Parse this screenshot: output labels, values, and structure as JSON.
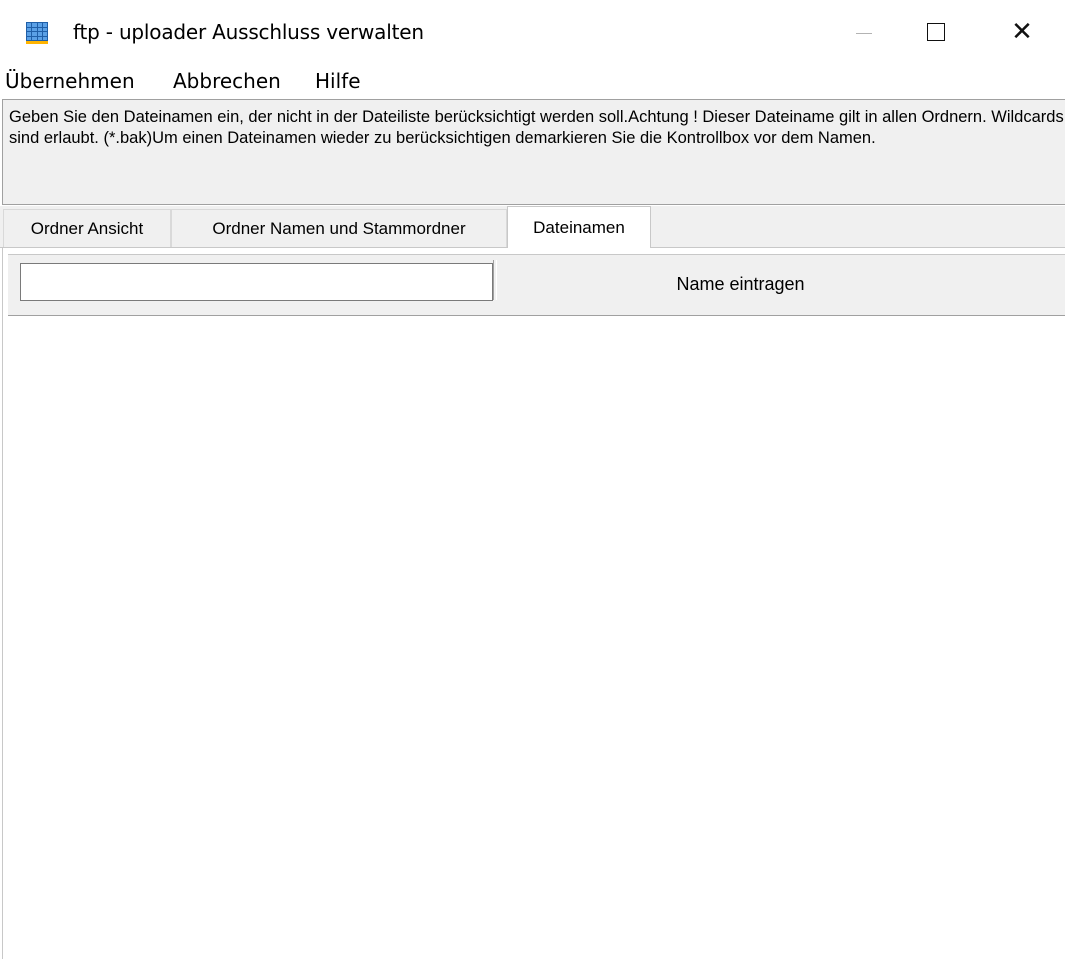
{
  "window": {
    "icon": "app-grid-icon",
    "title": "ftp - uploader  Ausschluss verwalten",
    "controls": {
      "minimize": "minimize-icon",
      "maximize": "maximize-icon",
      "close": "close-icon",
      "close_glyph": "✕"
    }
  },
  "menu": {
    "items": [
      {
        "label": "Übernehmen"
      },
      {
        "label": "Abbrechen"
      },
      {
        "label": "Hilfe"
      }
    ]
  },
  "info": {
    "text": "Geben Sie den Dateinamen ein, der nicht in der Dateiliste berücksichtigt werden soll.Achtung ! Dieser Dateiname gilt in allen Ordnern. Wildcards sind erlaubt. (*.bak)Um einen Dateinamen wieder zu berücksichtigen demarkieren Sie die Kontrollbox vor dem Namen."
  },
  "tabs": [
    {
      "label": "Ordner Ansicht",
      "active": false
    },
    {
      "label": "Ordner Namen und Stammordner",
      "active": false
    },
    {
      "label": "Dateinamen",
      "active": true
    }
  ],
  "entry": {
    "value": "",
    "button_label": "Name eintragen"
  },
  "colors": {
    "window_bg": "#ffffff",
    "panel_bg": "#f0f0f0",
    "icon_blue": "#1f5fa8"
  }
}
